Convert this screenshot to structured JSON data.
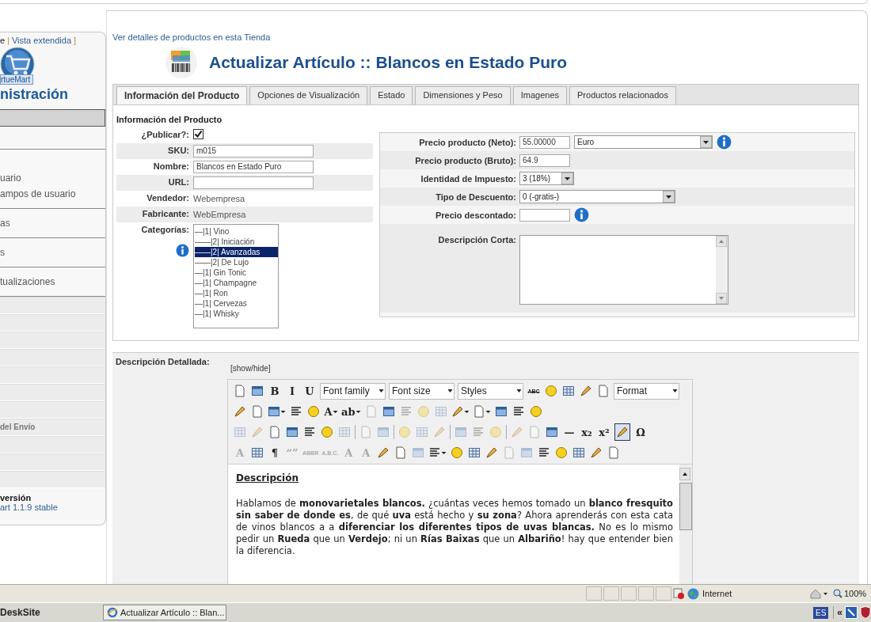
{
  "sidebar": {
    "view_toggle": {
      "current": "e",
      "separator": "|",
      "link": "Vista extendida",
      "close": "]"
    },
    "logo_label": "rtueMart",
    "heading": "nistración",
    "menu": [
      {
        "kind": "bar",
        "selected": true
      },
      {
        "kind": "section",
        "items": [
          "uario",
          "ampos de usuario"
        ]
      },
      {
        "kind": "section",
        "items": [
          "as"
        ]
      },
      {
        "kind": "section",
        "items": [
          "s"
        ]
      },
      {
        "kind": "section",
        "items": [
          "tualizaciones"
        ]
      },
      {
        "kind": "bar",
        "selected": false
      },
      {
        "kind": "bar",
        "selected": false
      },
      {
        "kind": "bar",
        "selected": false
      },
      {
        "kind": "bar",
        "selected": false
      },
      {
        "kind": "bar",
        "selected": false
      },
      {
        "kind": "bar",
        "selected": false
      },
      {
        "kind": "bar",
        "selected": false
      },
      {
        "kind": "bar",
        "selected": false,
        "label": "del Envío"
      },
      {
        "kind": "bar",
        "selected": false
      },
      {
        "kind": "bar",
        "selected": false
      },
      {
        "kind": "bar",
        "selected": false
      }
    ],
    "version": {
      "title": "versión",
      "link": "art 1.1.9 stable"
    }
  },
  "details_link": "Ver detalles de productos en esta Tienda",
  "title": "Actualizar Artículo :: Blancos en Estado Puro",
  "tabs": [
    {
      "label": "Información del Producto",
      "selected": true
    },
    {
      "label": "Opciones de Visualización",
      "selected": false
    },
    {
      "label": "Estado",
      "selected": false
    },
    {
      "label": "Dimensiones y Peso",
      "selected": false
    },
    {
      "label": "Imagenes",
      "selected": false
    },
    {
      "label": "Productos relacionados",
      "selected": false
    }
  ],
  "product_info": {
    "heading": "Información del Producto",
    "fields": [
      {
        "kind": "checkbox",
        "label": "¿Publicar?:",
        "checked": true
      },
      {
        "kind": "input",
        "label": "SKU:",
        "value": "m015"
      },
      {
        "kind": "input",
        "label": "Nombre:",
        "value": "Blancos en Estado Puro"
      },
      {
        "kind": "input",
        "label": "URL:"
      },
      {
        "kind": "text",
        "label": "Vendedor:",
        "value": "Webempresa"
      },
      {
        "kind": "text",
        "label": "Fabricante:",
        "value": "WebEmpresa"
      },
      {
        "kind": "listbox",
        "label": "Categorías:",
        "options": [
          {
            "label": "—|1| Vino",
            "selected": false
          },
          {
            "label": "——|2| Iniciación",
            "selected": false
          },
          {
            "label": "——|2| Avanzadas",
            "selected": true
          },
          {
            "label": "——|2| De Lujo",
            "selected": false
          },
          {
            "label": "—|1| Gin Tonic",
            "selected": false
          },
          {
            "label": "—|1| Champagne",
            "selected": false
          },
          {
            "label": "—|1| Ron",
            "selected": false
          },
          {
            "label": "—|1| Cervezas",
            "selected": false
          },
          {
            "label": "—|1| Whisky",
            "selected": false
          }
        ]
      }
    ]
  },
  "pricing": {
    "fields": [
      {
        "kind": "input-select",
        "label": "Precio producto (Neto):",
        "value": "55.00000",
        "select": "Euro",
        "info": true
      },
      {
        "kind": "input",
        "label": "Precio producto (Bruto):",
        "value": "64.9",
        "info": false
      },
      {
        "kind": "select",
        "label": "Identidad de Impuesto:",
        "value": "3 (18%)",
        "info": false
      },
      {
        "kind": "select-wide",
        "label": "Tipo de Descuento:",
        "value": "0 (-gratis-)",
        "info": false
      },
      {
        "kind": "input",
        "label": "Precio descontado:",
        "info": true
      },
      {
        "kind": "textarea",
        "label": "Descripción Corta:",
        "info": false
      }
    ]
  },
  "description": {
    "label": "Descripción Detallada:",
    "toggle": "[show/hide]",
    "toolbar": [
      [
        {
          "kind": "icon",
          "disabled": false,
          "pressed": false
        },
        {
          "kind": "icon",
          "disabled": false,
          "pressed": false
        },
        {
          "kind": "glyph",
          "label": "B",
          "disabled": false,
          "pressed": false
        },
        {
          "kind": "glyph",
          "label": "I",
          "disabled": false,
          "pressed": false
        },
        {
          "kind": "glyph",
          "label": "U",
          "disabled": false,
          "pressed": false
        },
        {
          "kind": "select",
          "label": "Font family"
        },
        {
          "kind": "select",
          "label": "Font size"
        },
        {
          "kind": "select",
          "label": "Styles"
        },
        {
          "kind": "glyph",
          "label": "ABC",
          "disabled": false,
          "pressed": false
        },
        {
          "kind": "icon",
          "disabled": false,
          "pressed": false
        },
        {
          "kind": "icon",
          "disabled": false,
          "pressed": false
        },
        {
          "kind": "icon",
          "disabled": false,
          "pressed": false
        },
        {
          "kind": "icon",
          "disabled": false,
          "pressed": false
        },
        {
          "kind": "select",
          "label": "Format"
        }
      ],
      [
        {
          "kind": "icon",
          "disabled": false,
          "pressed": false
        },
        {
          "kind": "icon",
          "disabled": false,
          "pressed": false
        },
        {
          "kind": "icon-menu",
          "disabled": false,
          "pressed": false
        },
        {
          "kind": "icon",
          "disabled": false,
          "pressed": false
        },
        {
          "kind": "icon",
          "disabled": false,
          "pressed": false
        },
        {
          "kind": "glyph-menu",
          "label": "A",
          "disabled": false,
          "pressed": false
        },
        {
          "kind": "glyph-menu",
          "label": "ab",
          "disabled": false,
          "pressed": false
        },
        {
          "kind": "icon",
          "disabled": true,
          "pressed": false
        },
        {
          "kind": "icon",
          "disabled": false,
          "pressed": false
        },
        {
          "kind": "icon",
          "disabled": true,
          "pressed": false
        },
        {
          "kind": "icon",
          "disabled": true,
          "pressed": false
        },
        {
          "kind": "icon",
          "disabled": true,
          "pressed": false
        },
        {
          "kind": "icon-menu",
          "disabled": false,
          "pressed": false
        },
        {
          "kind": "icon-menu",
          "disabled": false,
          "pressed": false
        },
        {
          "kind": "icon",
          "disabled": false,
          "pressed": false
        },
        {
          "kind": "icon",
          "disabled": false,
          "pressed": false
        },
        {
          "kind": "icon",
          "disabled": false,
          "pressed": false
        }
      ],
      [
        {
          "kind": "icon",
          "disabled": true,
          "pressed": false
        },
        {
          "kind": "icon",
          "disabled": true,
          "pressed": false
        },
        {
          "kind": "icon",
          "disabled": false,
          "pressed": false
        },
        {
          "kind": "icon",
          "disabled": false,
          "pressed": false
        },
        {
          "kind": "icon",
          "disabled": false,
          "pressed": false
        },
        {
          "kind": "icon",
          "disabled": false,
          "pressed": false
        },
        {
          "kind": "icon",
          "disabled": true,
          "pressed": false
        },
        {
          "kind": "sep"
        },
        {
          "kind": "icon",
          "disabled": true,
          "pressed": false
        },
        {
          "kind": "icon",
          "disabled": true,
          "pressed": false
        },
        {
          "kind": "sep"
        },
        {
          "kind": "icon",
          "disabled": true,
          "pressed": false
        },
        {
          "kind": "icon",
          "disabled": true,
          "pressed": false
        },
        {
          "kind": "icon",
          "disabled": true,
          "pressed": false
        },
        {
          "kind": "sep"
        },
        {
          "kind": "icon",
          "disabled": true,
          "pressed": false
        },
        {
          "kind": "icon",
          "disabled": true,
          "pressed": false
        },
        {
          "kind": "icon",
          "disabled": true,
          "pressed": false
        },
        {
          "kind": "sep"
        },
        {
          "kind": "icon",
          "disabled": true,
          "pressed": false
        },
        {
          "kind": "icon",
          "disabled": true,
          "pressed": false
        },
        {
          "kind": "icon",
          "disabled": false,
          "pressed": false
        },
        {
          "kind": "glyph",
          "label": "—",
          "disabled": false,
          "pressed": false
        },
        {
          "kind": "glyph",
          "label": "x₂",
          "disabled": false,
          "pressed": false
        },
        {
          "kind": "glyph",
          "label": "x²",
          "disabled": false,
          "pressed": false
        },
        {
          "kind": "icon",
          "disabled": false,
          "pressed": true
        },
        {
          "kind": "glyph",
          "label": "Ω",
          "disabled": false,
          "pressed": false
        }
      ],
      [
        {
          "kind": "glyph",
          "label": "A",
          "disabled": true,
          "pressed": false
        },
        {
          "kind": "icon",
          "disabled": false,
          "pressed": false
        },
        {
          "kind": "glyph",
          "label": "¶",
          "disabled": false,
          "pressed": false
        },
        {
          "kind": "glyph",
          "label": "“”",
          "disabled": true,
          "pressed": false
        },
        {
          "kind": "glyph",
          "label": "ABBR",
          "disabled": true,
          "pressed": false
        },
        {
          "kind": "glyph",
          "label": "A.B.C.",
          "disabled": true,
          "pressed": false
        },
        {
          "kind": "glyph",
          "label": "A",
          "disabled": true,
          "pressed": false
        },
        {
          "kind": "glyph",
          "label": "A",
          "disabled": true,
          "pressed": false
        },
        {
          "kind": "icon",
          "disabled": false,
          "pressed": false
        },
        {
          "kind": "icon",
          "disabled": false,
          "pressed": false
        },
        {
          "kind": "icon",
          "disabled": true,
          "pressed": false
        },
        {
          "kind": "icon-menu",
          "disabled": false,
          "pressed": false
        },
        {
          "kind": "icon",
          "disabled": false,
          "pressed": false
        },
        {
          "kind": "icon",
          "disabled": false,
          "pressed": false
        },
        {
          "kind": "icon",
          "disabled": false,
          "pressed": false
        },
        {
          "kind": "icon",
          "disabled": true,
          "pressed": false
        },
        {
          "kind": "icon",
          "disabled": true,
          "pressed": false
        },
        {
          "kind": "icon",
          "disabled": false,
          "pressed": false
        },
        {
          "kind": "icon",
          "disabled": false,
          "pressed": false
        },
        {
          "kind": "icon",
          "disabled": false,
          "pressed": false
        },
        {
          "kind": "icon",
          "disabled": false,
          "pressed": false
        },
        {
          "kind": "icon",
          "disabled": false,
          "pressed": false
        }
      ]
    ],
    "content_heading": "Descripción",
    "content_paragraph": "Hablamos de **monovarietales blancos.** ¿cuántas veces hemos tomado un **blanco fresquito sin saber de donde es**, de qué **uva** está hecho y **su zona**? Ahora aprenderás con esta cata de vinos blancos a a **diferenciar los diferentes tipos de uvas blancas.** No es lo mismo pedir un **Rueda** que un **Verdejo**; ni un **Rías Baixas** que un **Albariño**!  hay que entender bien la diferencia."
  },
  "status_bar": {
    "zone": "Internet",
    "zoom": "100%"
  },
  "taskbar": {
    "start": "DeskSite",
    "task": "Actualizar Artículo :: Blan...",
    "language": "ES",
    "collapse": "«"
  }
}
